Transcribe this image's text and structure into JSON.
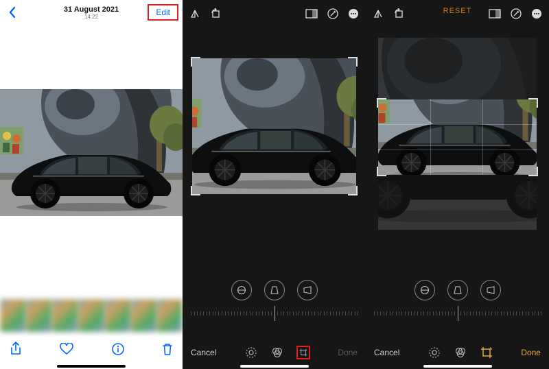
{
  "viewer": {
    "date": "31 August 2021",
    "time": "14:22",
    "edit_label": "Edit"
  },
  "editor2": {
    "cancel_label": "Cancel",
    "done_label": "Done"
  },
  "editor3": {
    "reset_label": "RESET",
    "cancel_label": "Cancel",
    "done_label": "Done"
  },
  "colors": {
    "ios_blue": "#0066ff",
    "accent_orange": "#e2a93a",
    "highlight_red": "#e02020"
  }
}
